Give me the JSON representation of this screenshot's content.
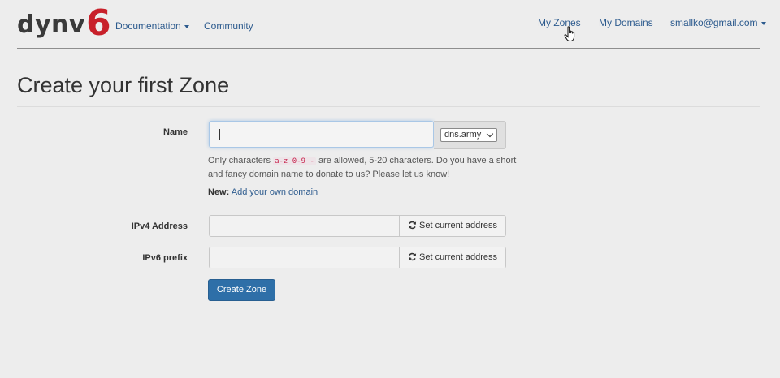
{
  "brand": {
    "logo_text": "dynv",
    "logo_accent": "6",
    "accent_color": "#c8202a"
  },
  "nav": {
    "documentation": "Documentation",
    "community": "Community",
    "my_zones": "My Zones",
    "my_domains": "My Domains",
    "user_email": "smallko@gmail.com"
  },
  "page": {
    "title": "Create your first Zone"
  },
  "form": {
    "name": {
      "label": "Name",
      "value": "",
      "domain_select": "dns.army",
      "help_prefix": "Only characters",
      "help_code": "a-z 0-9 -",
      "help_suffix": "are allowed, 5-20 characters. Do you have a short and fancy domain name to donate to us? Please let us know!",
      "new_label": "New:",
      "new_link": "Add your own domain"
    },
    "ipv4": {
      "label": "IPv4 Address",
      "value": "",
      "button": "Set current address"
    },
    "ipv6": {
      "label": "IPv6 prefix",
      "value": "",
      "button": "Set current address"
    },
    "submit": "Create Zone"
  },
  "colors": {
    "link": "#2d5b8e",
    "primary_button": "#2e6fa8",
    "background": "#ededed"
  },
  "icons": {
    "refresh": "refresh-icon",
    "cursor": "hand-cursor-icon"
  }
}
